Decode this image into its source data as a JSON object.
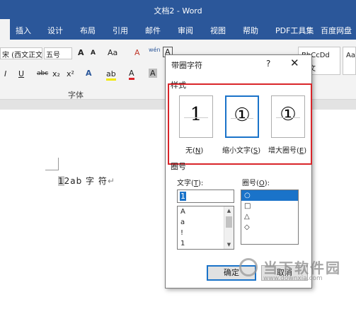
{
  "window": {
    "title": "文档2 - Word"
  },
  "ribbon_tabs": [
    "插入",
    "设计",
    "布局",
    "引用",
    "邮件",
    "审阅",
    "视图",
    "帮助",
    "PDF工具集",
    "百度网盘"
  ],
  "ribbon": {
    "font_name": "宋 (西文正文)",
    "font_size": "五号",
    "grow_font": "A",
    "shrink_font": "A",
    "change_case": "Aa",
    "clear_format": "A",
    "phonetic": "wén",
    "enclose": "A",
    "italic": "I",
    "underline": "U",
    "strike": "abc",
    "subscript": "x₂",
    "superscript": "x²",
    "text_effect": "A",
    "highlight": "ab",
    "font_color": "A",
    "shade": "A",
    "font_group_label": "字体",
    "style_preview_1": "BbCcDd",
    "style_preview_1_label": "正文",
    "style_preview_2": "Aa"
  },
  "document": {
    "selected_char": "1",
    "text": "2ab 字 符",
    "para_mark": "↵"
  },
  "dialog": {
    "title": "带圈字符",
    "help": "?",
    "close": "✕",
    "style_section": "样式",
    "options": [
      {
        "glyph": "1",
        "label": "无",
        "key": "N"
      },
      {
        "glyph": "①",
        "label": "缩小文字",
        "key": "S"
      },
      {
        "glyph": "①",
        "label": "增大圈号",
        "key": "E"
      }
    ],
    "circle_section": "圈号",
    "text_label": "文字",
    "text_key": "T",
    "circle_label": "圈号",
    "circle_key": "O",
    "text_value": "1",
    "text_list": [
      "A",
      "a",
      "!",
      "1"
    ],
    "circle_list": [
      "○",
      "□",
      "△",
      "◇"
    ],
    "ok": "确定",
    "cancel": "取消"
  },
  "watermark": {
    "text": "当下软件园",
    "url": "www.downxia.com"
  },
  "colors": {
    "accent": "#2b579a",
    "selection": "#1a73c9",
    "highlight_red": "#d9252a"
  }
}
